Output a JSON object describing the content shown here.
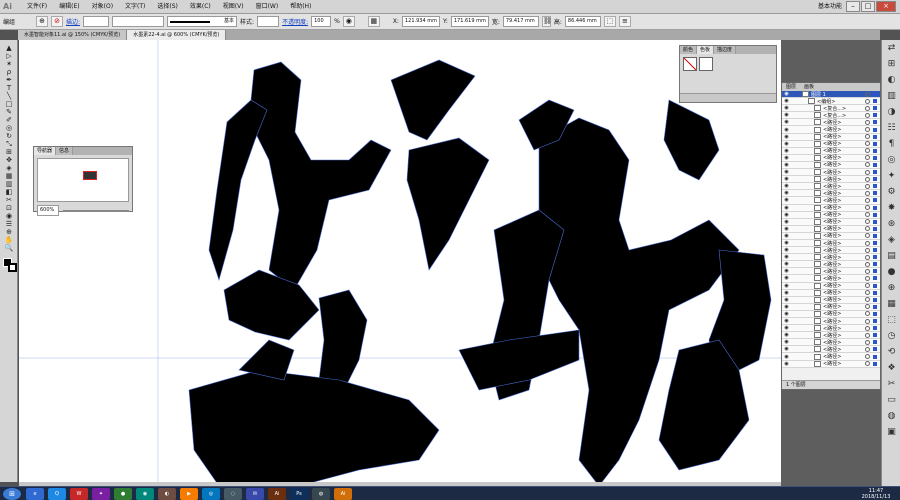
{
  "app": {
    "logo": "Ai",
    "workspace": "基本功能"
  },
  "menu": [
    "文件(F)",
    "编辑(E)",
    "对象(O)",
    "文字(T)",
    "选择(S)",
    "效果(C)",
    "视图(V)",
    "窗口(W)",
    "帮助(H)"
  ],
  "window_controls": {
    "minimize": "–",
    "maximize": "□",
    "close": "×"
  },
  "control_bar": {
    "selection_label": "编组",
    "stroke_label": "描边:",
    "stroke_value": "",
    "style_preset": "基本",
    "style_label": "样式:",
    "opacity_label": "不透明度:",
    "opacity_value": "100",
    "opacity_unit": "%",
    "x_label": "X:",
    "x_value": "121.934 mm",
    "y_label": "Y:",
    "y_value": "171.619 mm",
    "w_label": "宽:",
    "w_value": "79.417 mm",
    "h_label": "高:",
    "h_value": "86.446 mm"
  },
  "doc_tabs": [
    {
      "label": "水墨智能对象11.ai @ 150% (CMYK/预览)",
      "active": false
    },
    {
      "label": "水墨素22-4.ai @ 600% (CMYK/预览)",
      "active": true
    }
  ],
  "tools": [
    "▲",
    "▷",
    "✶",
    "ρ",
    "✒",
    "T",
    "╲",
    "□",
    "✎",
    "✐",
    "◎",
    "↻",
    "⤡",
    "⊞",
    "✥",
    "◈",
    "▦",
    "▥",
    "◧",
    "✂",
    "⊡",
    "◉",
    "☰",
    "⊕",
    "✋",
    "🔍"
  ],
  "color_panel": {
    "tabs": [
      "颜色",
      "色板",
      "描边度"
    ],
    "active_tab": 1
  },
  "navigator": {
    "tabs": [
      "导航器",
      "信息"
    ],
    "zoom": "600%"
  },
  "layers": {
    "tabs": [
      "图层",
      "画板"
    ],
    "rows": [
      {
        "name": "图层 1",
        "selected": true
      },
      {
        "name": "<编组>",
        "selected": false
      },
      {
        "name": "<复合...>",
        "selected": false
      },
      {
        "name": "<复合...>",
        "selected": false
      },
      {
        "name": "<路径>",
        "selected": false
      },
      {
        "name": "<路径>",
        "selected": false
      },
      {
        "name": "<路径>",
        "selected": false
      },
      {
        "name": "<路径>",
        "selected": false
      },
      {
        "name": "<路径>",
        "selected": false
      },
      {
        "name": "<路径>",
        "selected": false
      },
      {
        "name": "<路径>",
        "selected": false
      },
      {
        "name": "<路径>",
        "selected": false
      },
      {
        "name": "<路径>",
        "selected": false
      },
      {
        "name": "<路径>",
        "selected": false
      },
      {
        "name": "<路径>",
        "selected": false
      },
      {
        "name": "<路径>",
        "selected": false
      },
      {
        "name": "<路径>",
        "selected": false
      },
      {
        "name": "<路径>",
        "selected": false
      },
      {
        "name": "<路径>",
        "selected": false
      },
      {
        "name": "<路径>",
        "selected": false
      },
      {
        "name": "<路径>",
        "selected": false
      },
      {
        "name": "<路径>",
        "selected": false
      },
      {
        "name": "<路径>",
        "selected": false
      },
      {
        "name": "<路径>",
        "selected": false
      },
      {
        "name": "<路径>",
        "selected": false
      },
      {
        "name": "<路径>",
        "selected": false
      },
      {
        "name": "<路径>",
        "selected": false
      },
      {
        "name": "<路径>",
        "selected": false
      },
      {
        "name": "<路径>",
        "selected": false
      },
      {
        "name": "<路径>",
        "selected": false
      },
      {
        "name": "<路径>",
        "selected": false
      },
      {
        "name": "<路径>",
        "selected": false
      },
      {
        "name": "<路径>",
        "selected": false
      },
      {
        "name": "<路径>",
        "selected": false
      },
      {
        "name": "<路径>",
        "selected": false
      },
      {
        "name": "<路径>",
        "selected": false
      },
      {
        "name": "<路径>",
        "selected": false
      },
      {
        "name": "<路径>",
        "selected": false
      },
      {
        "name": "<路径>",
        "selected": false
      }
    ],
    "footer": "1 个图层"
  },
  "right_icons": [
    "⇄",
    "⊞",
    "◐",
    "▥",
    "◑",
    "☷",
    "¶",
    "◎",
    "✦",
    "⚙",
    "✸",
    "⊛",
    "◈",
    "▤",
    "●",
    "⊕",
    "▦",
    "⬚",
    "◷",
    "⟲",
    "❖",
    "✂",
    "▭",
    "◍",
    "▣"
  ],
  "taskbar": {
    "start": "⊞",
    "apps": [
      {
        "label": "e",
        "color": "#2e6ad1"
      },
      {
        "label": "Q",
        "color": "#1e88e5"
      },
      {
        "label": "W",
        "color": "#c62828"
      },
      {
        "label": "✦",
        "color": "#7b1fa2"
      },
      {
        "label": "●",
        "color": "#2e7d32"
      },
      {
        "label": "◉",
        "color": "#00897b"
      },
      {
        "label": "◐",
        "color": "#6d4c41"
      },
      {
        "label": "▶",
        "color": "#f57c00"
      },
      {
        "label": "◎",
        "color": "#0277bd"
      },
      {
        "label": "◌",
        "color": "#455a64"
      },
      {
        "label": "✉",
        "color": "#3949ab"
      },
      {
        "label": "Ai",
        "color": "#6b2e0e"
      },
      {
        "label": "Ps",
        "color": "#0d2f5a"
      },
      {
        "label": "◍",
        "color": "#37474f"
      },
      {
        "label": "Ai",
        "color": "#d06e0a"
      }
    ],
    "time": "11:47",
    "date": "2018/11/13"
  },
  "colors": {
    "selection_blue": "#2f57b8",
    "anchor_blue": "#4a6cd4",
    "ink": "#000000"
  }
}
